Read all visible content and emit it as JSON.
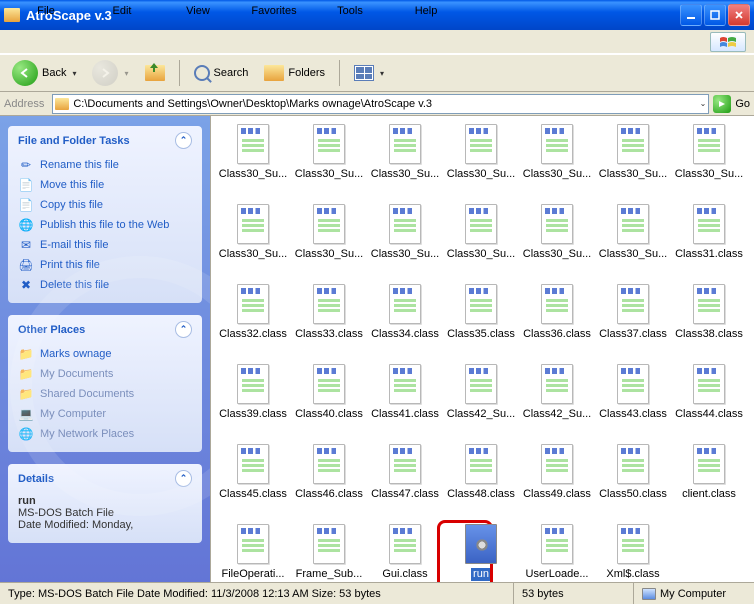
{
  "window": {
    "title": "AtroScape v.3"
  },
  "menu": {
    "file": "File",
    "edit": "Edit",
    "view": "View",
    "favorites": "Favorites",
    "tools": "Tools",
    "help": "Help"
  },
  "toolbar": {
    "back": "Back",
    "search": "Search",
    "folders": "Folders"
  },
  "address": {
    "label": "Address",
    "path": "C:\\Documents and Settings\\Owner\\Desktop\\Marks ownage\\AtroScape v.3",
    "go": "Go"
  },
  "tasks": {
    "title": "File and Folder Tasks",
    "items": [
      "Rename this file",
      "Move this file",
      "Copy this file",
      "Publish this file to the Web",
      "E-mail this file",
      "Print this file",
      "Delete this file"
    ]
  },
  "places": {
    "title": "Other Places",
    "items": [
      "Marks ownage",
      "My Documents",
      "Shared Documents",
      "My Computer",
      "My Network Places"
    ]
  },
  "details": {
    "title": "Details",
    "name": "run",
    "type": "MS-DOS Batch File",
    "modified": "Date Modified: Monday,"
  },
  "files": [
    {
      "n": "Class30_Su...",
      "t": "class"
    },
    {
      "n": "Class30_Su...",
      "t": "class"
    },
    {
      "n": "Class30_Su...",
      "t": "class"
    },
    {
      "n": "Class30_Su...",
      "t": "class"
    },
    {
      "n": "Class30_Su...",
      "t": "class"
    },
    {
      "n": "Class30_Su...",
      "t": "class"
    },
    {
      "n": "Class30_Su...",
      "t": "class"
    },
    {
      "n": "Class30_Su...",
      "t": "class"
    },
    {
      "n": "Class30_Su...",
      "t": "class"
    },
    {
      "n": "Class30_Su...",
      "t": "class"
    },
    {
      "n": "Class30_Su...",
      "t": "class"
    },
    {
      "n": "Class30_Su...",
      "t": "class"
    },
    {
      "n": "Class30_Su...",
      "t": "class"
    },
    {
      "n": "Class31.class",
      "t": "class"
    },
    {
      "n": "Class32.class",
      "t": "class"
    },
    {
      "n": "Class33.class",
      "t": "class"
    },
    {
      "n": "Class34.class",
      "t": "class"
    },
    {
      "n": "Class35.class",
      "t": "class"
    },
    {
      "n": "Class36.class",
      "t": "class"
    },
    {
      "n": "Class37.class",
      "t": "class"
    },
    {
      "n": "Class38.class",
      "t": "class"
    },
    {
      "n": "Class39.class",
      "t": "class"
    },
    {
      "n": "Class40.class",
      "t": "class"
    },
    {
      "n": "Class41.class",
      "t": "class"
    },
    {
      "n": "Class42_Su...",
      "t": "class"
    },
    {
      "n": "Class42_Su...",
      "t": "class"
    },
    {
      "n": "Class43.class",
      "t": "class"
    },
    {
      "n": "Class44.class",
      "t": "class"
    },
    {
      "n": "Class45.class",
      "t": "class"
    },
    {
      "n": "Class46.class",
      "t": "class"
    },
    {
      "n": "Class47.class",
      "t": "class"
    },
    {
      "n": "Class48.class",
      "t": "class"
    },
    {
      "n": "Class49.class",
      "t": "class"
    },
    {
      "n": "Class50.class",
      "t": "class"
    },
    {
      "n": "client.class",
      "t": "class"
    },
    {
      "n": "FileOperati...",
      "t": "class"
    },
    {
      "n": "Frame_Sub...",
      "t": "class"
    },
    {
      "n": "Gui.class",
      "t": "class"
    },
    {
      "n": "run",
      "t": "bat",
      "sel": true,
      "circle": true
    },
    {
      "n": "UserLoade...",
      "t": "class"
    },
    {
      "n": "Xml$.class",
      "t": "class"
    }
  ],
  "status": {
    "left": "Type: MS-DOS Batch File Date Modified: 11/3/2008 12:13 AM Size: 53 bytes",
    "size": "53 bytes",
    "loc": "My Computer"
  },
  "task_icons": [
    "✏",
    "📄",
    "📄",
    "🌐",
    "✉",
    "🖨",
    "✖"
  ],
  "place_icons": [
    "📁",
    "📁",
    "📁",
    "💻",
    "🌐"
  ]
}
